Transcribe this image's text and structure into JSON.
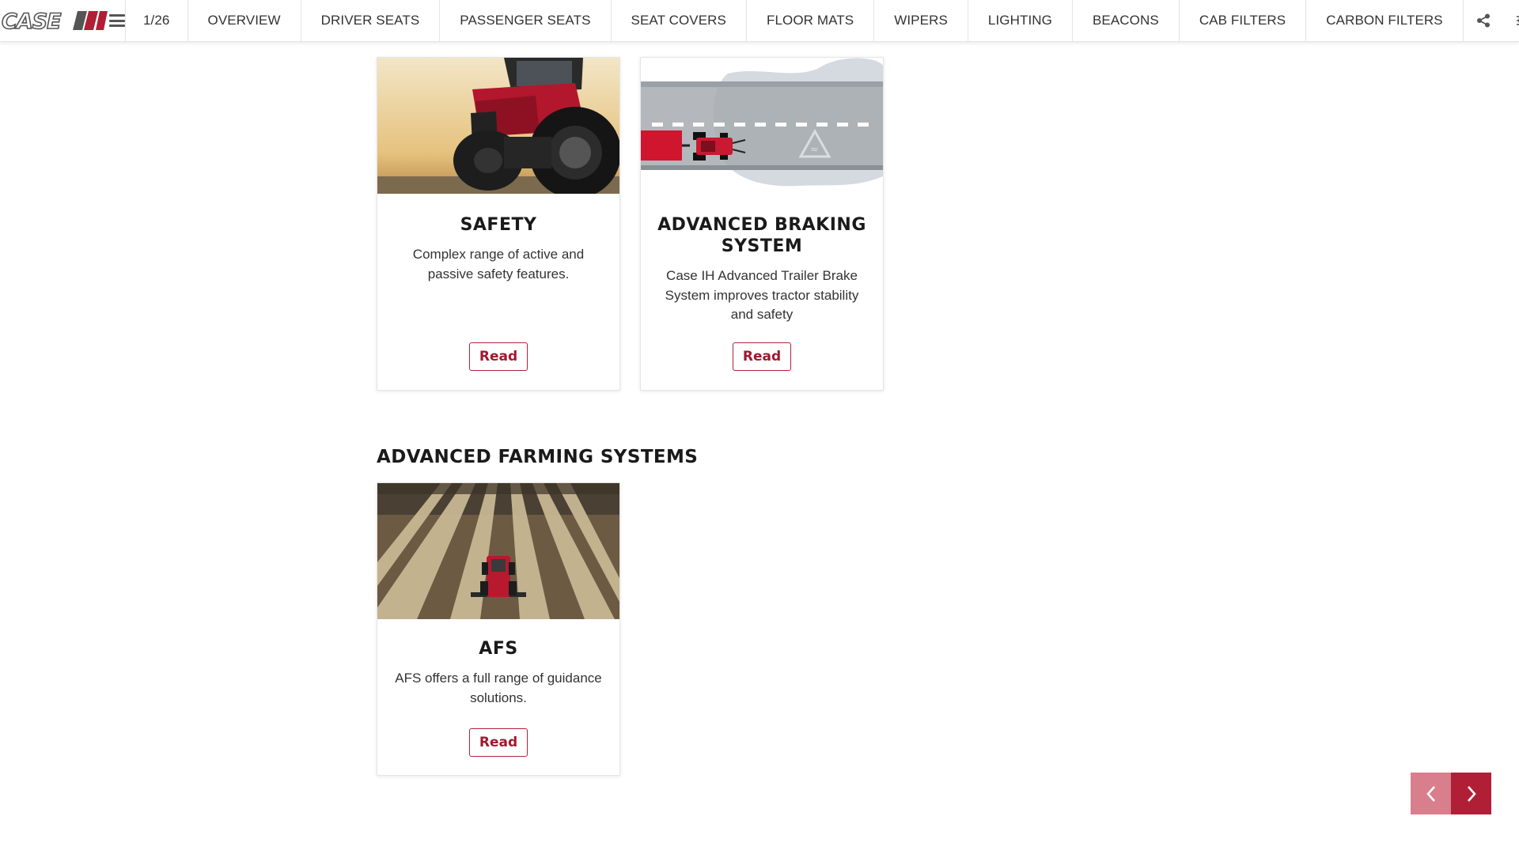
{
  "brand": {
    "logo_text": "CASE IH",
    "accent": "#b11f36"
  },
  "nav": {
    "counter": "1/26",
    "items": [
      "OVERVIEW",
      "DRIVER SEATS",
      "PASSENGER SEATS",
      "SEAT COVERS",
      "FLOOR MATS",
      "WIPERS",
      "LIGHTING",
      "BEACONS",
      "CAB FILTERS",
      "CARBON FILTERS"
    ],
    "tools": [
      "share-icon",
      "sliders-icon",
      "info-icon"
    ]
  },
  "cards": [
    {
      "title": "SAFETY",
      "description": "Complex range of active and passive safety features.",
      "button": "Read",
      "image": "tractor-front-photo"
    },
    {
      "title": "ADVANCED BRAKING SYSTEM",
      "description": "Case IH Advanced Trailer Brake System improves tractor stability and safety",
      "button": "Read",
      "image": "braking-road-illustration"
    }
  ],
  "section": {
    "title": "ADVANCED FARMING SYSTEMS",
    "cards": [
      {
        "title": "AFS",
        "description": "AFS offers a full range of guidance solutions.",
        "button": "Read",
        "image": "field-aerial-photo"
      }
    ]
  },
  "pager": {
    "prev_icon": "chevron-left-icon",
    "next_icon": "chevron-right-icon"
  }
}
